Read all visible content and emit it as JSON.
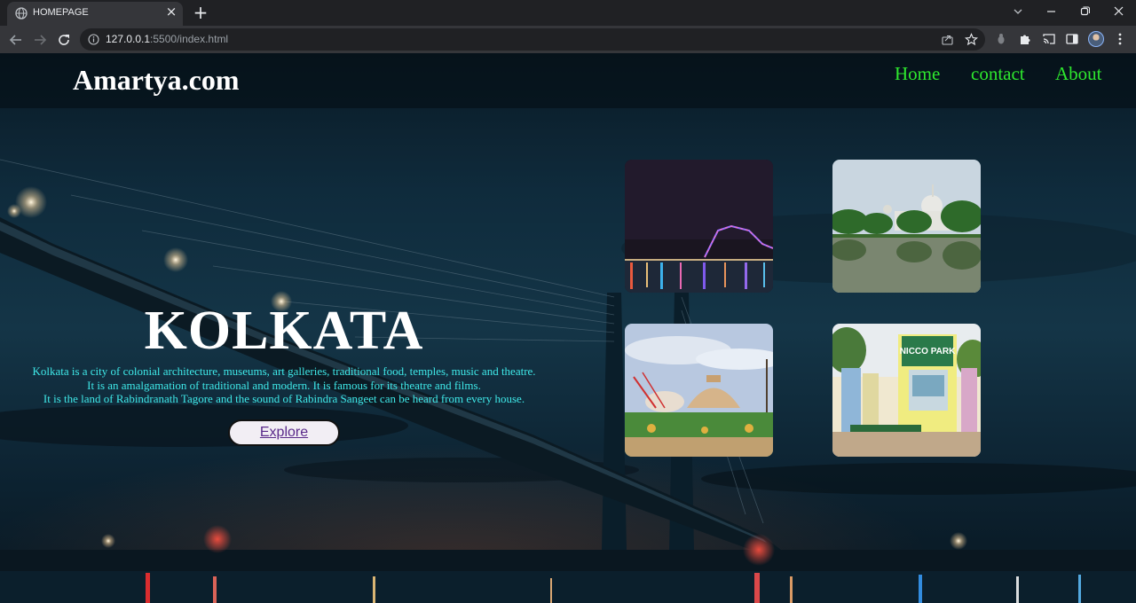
{
  "browser": {
    "tab_title": "HOMEPAGE",
    "url_host": "127.0.0.1",
    "url_rest": ":5500/index.html"
  },
  "site": {
    "brand": "Amartya.com",
    "nav": [
      {
        "label": "Home"
      },
      {
        "label": "contact"
      },
      {
        "label": "About"
      }
    ]
  },
  "hero": {
    "title": "KOLKATA",
    "description_lines": [
      "Kolkata is a city of colonial architecture, museums, art galleries, traditional food, temples, music and theatre.",
      "It is an amalgamation of traditional and modern. It is famous for its theatre and films.",
      "It is the land of Rabindranath Tagore and the sound of Rabindra Sangeet can be heard from every house."
    ],
    "button_label": "Explore"
  },
  "gallery": {
    "park_sign": "NICCO PARK"
  },
  "colors": {
    "nav_link": "#2ee82e",
    "hero_text": "#3fe8e8",
    "brand": "#ffffff"
  }
}
